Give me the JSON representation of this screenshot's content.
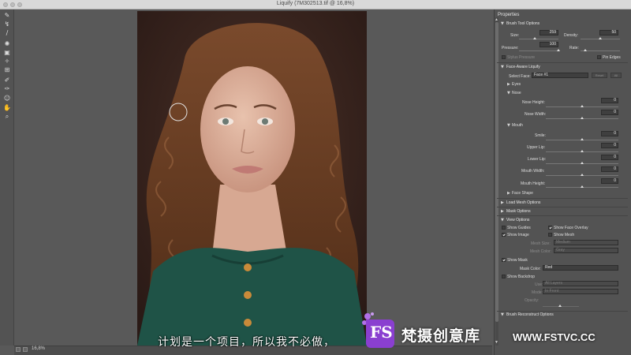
{
  "window": {
    "title": "Liquify (7M302513.tif @ 16,8%)"
  },
  "toolbar": {
    "tools": [
      "forward-warp-tool",
      "reconstruct-tool",
      "smooth-tool",
      "twirl-clockwise-tool",
      "pucker-tool",
      "bloat-tool",
      "push-left-tool",
      "freeze-mask-tool",
      "thaw-mask-tool",
      "face-tool",
      "hand-tool",
      "zoom-tool"
    ]
  },
  "status": {
    "zoom": "16,8%"
  },
  "panel": {
    "title": "Properties",
    "brush_tool_options": {
      "header": "Brush Tool Options",
      "size_label": "Size:",
      "size_value": "259",
      "density_label": "Density:",
      "density_value": "50",
      "pressure_label": "Pressure:",
      "pressure_value": "100",
      "rate_label": "Rate:",
      "stylus_pressure_label": "Stylus Pressure",
      "pin_edges_label": "Pin Edges"
    },
    "face_aware": {
      "header": "Face-Aware Liquify",
      "select_face_label": "Select Face:",
      "select_face_value": "Face #1",
      "reset_label": "Reset",
      "all_label": "All",
      "eyes_label": "Eyes",
      "nose_label": "Nose",
      "nose_height_label": "Nose Height:",
      "nose_height_value": "0",
      "nose_width_label": "Nose Width:",
      "nose_width_value": "0",
      "mouth_label": "Mouth",
      "smile_label": "Smile:",
      "smile_value": "0",
      "upper_lip_label": "Upper Lip:",
      "upper_lip_value": "0",
      "lower_lip_label": "Lower Lip:",
      "lower_lip_value": "0",
      "mouth_width_label": "Mouth Width:",
      "mouth_width_value": "0",
      "mouth_height_label": "Mouth Height:",
      "mouth_height_value": "0",
      "face_shape_label": "Face Shape"
    },
    "load_mesh_label": "Load Mesh Options",
    "mask_options_label": "Mask Options",
    "view_options": {
      "header": "View Options",
      "show_guides_label": "Show Guides",
      "show_face_overlay_label": "Show Face Overlay",
      "show_image_label": "Show Image",
      "show_mesh_label": "Show Mesh",
      "mesh_size_label": "Mesh Size:",
      "mesh_size_value": "Medium",
      "mesh_color_label": "Mesh Color:",
      "mesh_color_value": "Gray",
      "show_mask_label": "Show Mask",
      "mask_color_label": "Mask Color:",
      "mask_color_value": "Red",
      "show_backdrop_label": "Show Backdrop",
      "use_label": "Use:",
      "use_value": "All Layers",
      "mode_label": "Mode:",
      "mode_value": "In Front",
      "opacity_label": "Opacity:"
    },
    "brush_reconstruct_label": "Brush Reconstruct Options"
  },
  "subtitle": "计划是一个项目，所以我不必做，",
  "watermark": {
    "name": "梵摄创意库",
    "url": "WWW.FSTVC.CC",
    "badge": "FS"
  },
  "colors": {
    "panel_bg": "#535353",
    "canvas_bg": "#595959",
    "photo_bg": "#3b2822",
    "hair": "#6b3f24",
    "sweater": "#1f5347",
    "watermark_badge": "#8a3fd0"
  }
}
